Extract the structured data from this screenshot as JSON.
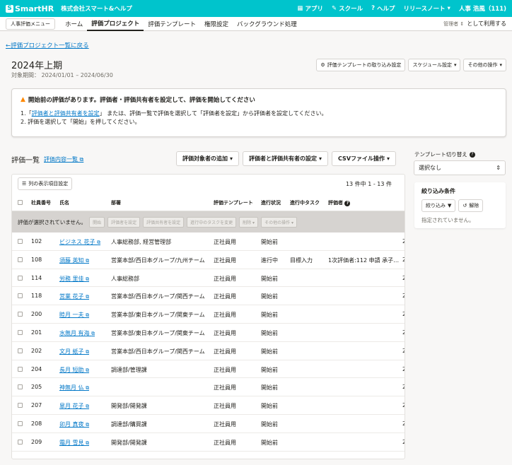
{
  "app": {
    "logo": "SmartHR",
    "company": "株式会社スマート&ヘルプ"
  },
  "topnav": {
    "apps": "アプリ",
    "school": "スクール",
    "help": "ヘルプ",
    "release": "リリースノート",
    "user": "人事 浩風（111)"
  },
  "subnav": {
    "menu": "人事評価メニュー",
    "tabs": [
      "ホーム",
      "評価プロジェクト",
      "評価テンプレート",
      "権限設定",
      "バックグラウンド処理"
    ],
    "role": "管理者",
    "role_suffix": "として利用する"
  },
  "page": {
    "back": "評価プロジェクト一覧に戻る",
    "title": "2024年上期",
    "period": "対象期間： 2024/01/01 – 2024/06/30",
    "btn_import": "評価テンプレートの取り込み設定",
    "btn_schedule": "スケジュール設定",
    "btn_other": "その他の操作"
  },
  "alert": {
    "title": "開始前の評価があります。評価者・評価共有者を設定して、評価を開始してください",
    "l1_prefix": "1.「",
    "l1_link": "評価者と評価共有者を設定",
    "l1_suffix": "」 または、評価一覧で評価を選択して「評価者を設定」から評価者を設定してください。",
    "l2": "2. 評価を選択して「開始」を押してください。"
  },
  "list": {
    "title": "評価一覧",
    "link": "評価内容一覧",
    "btn_add": "評価対象者の追加",
    "btn_raters": "評価者と評価共有者の設定",
    "btn_csv": "CSVファイル操作",
    "col_btn": "列の表示項目設定",
    "count": "13 件中 1 - 13 件",
    "headers": [
      "社員番号",
      "氏名",
      "部署",
      "評価テンプレート",
      "進行状況",
      "進行中タスク",
      "評価者"
    ],
    "bulk_msg": "評価が選択されていません。",
    "bulk_btns": [
      "開始",
      "評価者を設定",
      "評価共有者を設定",
      "進行中のタスクを変更",
      "削除",
      "その他の操作"
    ],
    "rows": [
      {
        "no": "102",
        "name": "ビジネス 花子",
        "dept": "人事総務部, 経営管理部",
        "tpl": "正社員用",
        "status": "開始前",
        "task": "",
        "rater": "",
        "extra": "2"
      },
      {
        "no": "108",
        "name": "須藤 英知",
        "dept": "営業本部/西日本グループ/九州チーム",
        "tpl": "正社員用",
        "status": "進行中",
        "task": "目標入力",
        "rater": "1次評価者:112 申請 承子…",
        "extra": "2"
      },
      {
        "no": "114",
        "name": "労務 里佳",
        "dept": "人事総務部",
        "tpl": "正社員用",
        "status": "開始前",
        "task": "",
        "rater": "",
        "extra": "2"
      },
      {
        "no": "118",
        "name": "営業 花子",
        "dept": "営業本部/西日本グループ/関西チーム",
        "tpl": "正社員用",
        "status": "開始前",
        "task": "",
        "rater": "",
        "extra": "2"
      },
      {
        "no": "200",
        "name": "睦月 一夫",
        "dept": "営業本部/東日本グループ/関東チーム",
        "tpl": "正社員用",
        "status": "開始前",
        "task": "",
        "rater": "",
        "extra": "2"
      },
      {
        "no": "201",
        "name": "水無月 有海",
        "dept": "営業本部/東日本グループ/関東チーム",
        "tpl": "正社員用",
        "status": "開始前",
        "task": "",
        "rater": "",
        "extra": "2"
      },
      {
        "no": "202",
        "name": "文月 紙子",
        "dept": "営業本部/西日本グループ/関西チーム",
        "tpl": "正社員用",
        "status": "開始前",
        "task": "",
        "rater": "",
        "extra": "2"
      },
      {
        "no": "204",
        "name": "長月 短助",
        "dept": "調達部/管理課",
        "tpl": "正社員用",
        "status": "開始前",
        "task": "",
        "rater": "",
        "extra": "2"
      },
      {
        "no": "205",
        "name": "神無月 仏",
        "dept": "",
        "tpl": "正社員用",
        "status": "開始前",
        "task": "",
        "rater": "",
        "extra": "2"
      },
      {
        "no": "207",
        "name": "皐月 花子",
        "dept": "開発部/開発課",
        "tpl": "正社員用",
        "status": "開始前",
        "task": "",
        "rater": "",
        "extra": "2"
      },
      {
        "no": "208",
        "name": "卯月 真夜",
        "dept": "調達部/購買課",
        "tpl": "正社員用",
        "status": "開始前",
        "task": "",
        "rater": "",
        "extra": "2"
      },
      {
        "no": "209",
        "name": "霜月 雪見",
        "dept": "開発部/開発課",
        "tpl": "正社員用",
        "status": "開始前",
        "task": "",
        "rater": "",
        "extra": "2"
      }
    ]
  },
  "side": {
    "label": "テンプレート切り替え",
    "select": "選択なし",
    "filter_title": "絞り込み条件",
    "filter_btn": "絞り込み",
    "reset_btn": "解除",
    "filter_note": "指定されていません。"
  }
}
